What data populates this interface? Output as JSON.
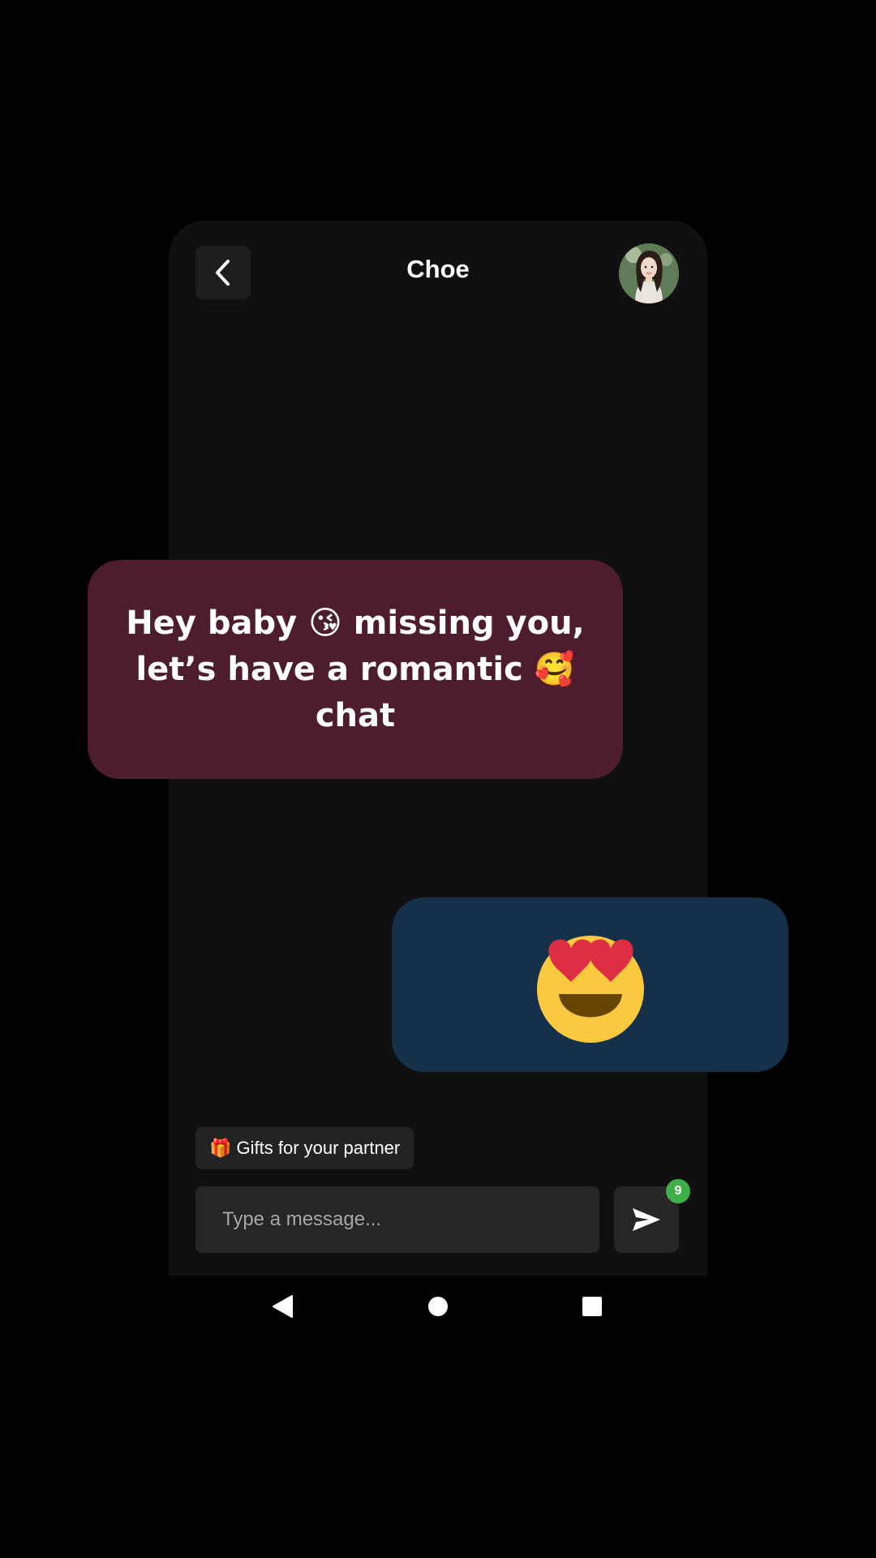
{
  "chat": {
    "title": "Choe",
    "avatar_icon": "contact-avatar-photo"
  },
  "messages": [
    {
      "direction": "received",
      "text": "Hey baby 😘 missing you, let’s have a romantic 🥰 chat",
      "bubble_color": "#4d1c2e"
    },
    {
      "direction": "sent",
      "emoji": "😍",
      "emoji_icon": "smiling-face-with-heart-eyes-icon",
      "bubble_color": "#16304a"
    }
  ],
  "gift_chip": {
    "label": "🎁 Gifts for your partner"
  },
  "composer": {
    "placeholder": "Type a message...",
    "value": "",
    "send_icon": "send-icon",
    "badge_count": "9"
  },
  "system_nav": {
    "back_icon": "back-triangle-icon",
    "home_icon": "home-circle-icon",
    "recents_icon": "recents-square-icon"
  },
  "colors": {
    "background": "#000000",
    "screen": "#101012",
    "received_bubble": "#4d1c2e",
    "sent_bubble": "#16304a",
    "badge": "#3fae4b",
    "controls": "#262628"
  }
}
